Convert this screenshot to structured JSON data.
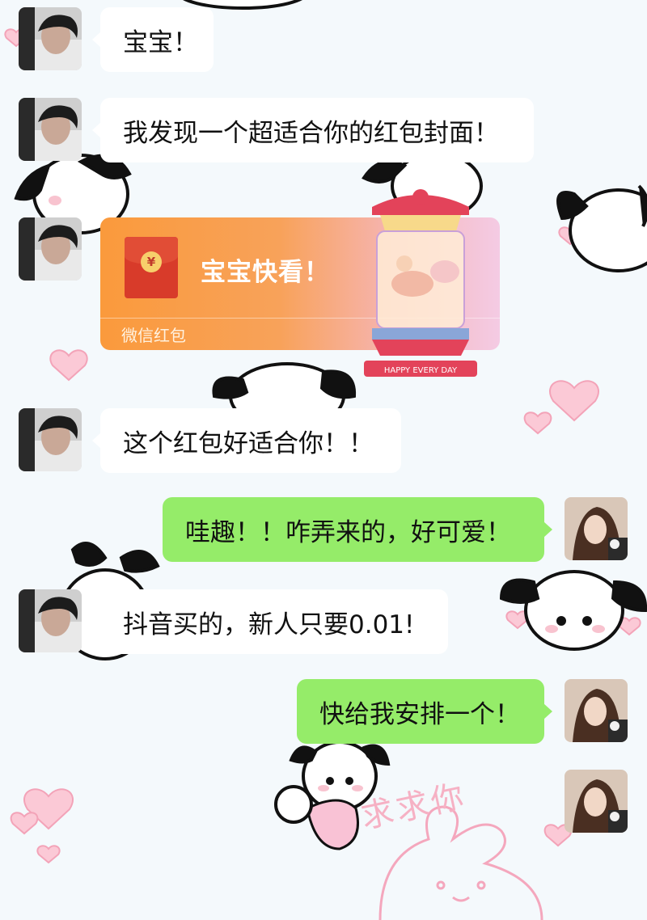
{
  "messages": [
    {
      "side": "left",
      "text": "宝宝！"
    },
    {
      "side": "left",
      "text": "我发现一个超适合你的红包封面！"
    },
    {
      "side": "left",
      "type": "red-packet",
      "title": "宝宝快看！",
      "footer": "微信红包",
      "cover_text": "HAPPY EVERY DAY"
    },
    {
      "side": "left",
      "text": "这个红包好适合你！！"
    },
    {
      "side": "right",
      "text": "哇趣！！咋弄来的，好可爱！"
    },
    {
      "side": "left",
      "text": "抖音买的，新人只要0.01!"
    },
    {
      "side": "right",
      "text": "快给我安排一个！"
    },
    {
      "side": "right",
      "type": "sticker"
    }
  ],
  "decor": {
    "watermark_text": "求求你"
  },
  "colors": {
    "self_bubble": "#95ec69",
    "other_bubble": "#ffffff",
    "red_packet": "#fa9a3c",
    "background": "#f4f9fc"
  }
}
